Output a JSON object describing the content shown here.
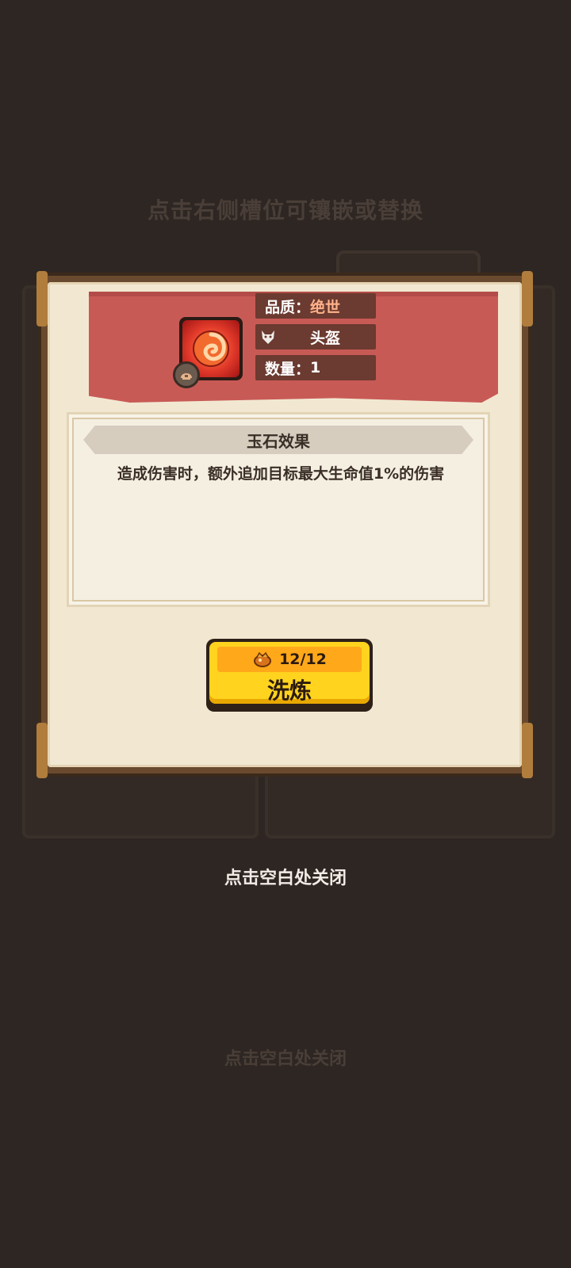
{
  "background": {
    "hint_top": "点击右侧槽位可镶嵌或替换",
    "hint_bottom": "点击空白处关闭"
  },
  "dialog": {
    "item": {
      "icon": "red-swirl-jade-icon",
      "slot_badge_icon": "helmet-slot-icon",
      "quality_label": "品质：",
      "quality_value": "绝世",
      "slot_icon": "wolf-helmet-icon",
      "slot_value": "头盔",
      "quantity_label": "数量：",
      "quantity_value": "1"
    },
    "effect": {
      "title": "玉石效果",
      "text": "造成伤害时，额外追加目标最大生命值1%的伤害"
    },
    "refine_button": {
      "cost_icon": "refine-stone-icon",
      "cost": "12/12",
      "label": "洗炼"
    }
  },
  "close_hint": "点击空白处关闭",
  "colors": {
    "banner": "#c85a56",
    "quality_accent": "#ffb28a",
    "button_yellow": "#ffd31e",
    "button_orange": "#ffa81a"
  }
}
